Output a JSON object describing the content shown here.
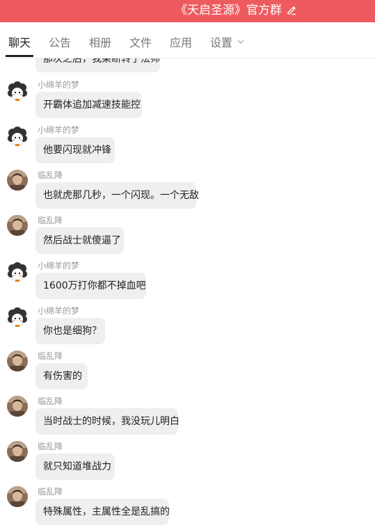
{
  "header": {
    "title": "《天启圣源》官方群",
    "background": "#ee5b5f"
  },
  "tabs": [
    {
      "label": "聊天",
      "active": true
    },
    {
      "label": "公告",
      "active": false
    },
    {
      "label": "相册",
      "active": false
    },
    {
      "label": "文件",
      "active": false
    },
    {
      "label": "应用",
      "active": false
    },
    {
      "label": "设置",
      "active": false,
      "has_dropdown": true
    }
  ],
  "icons": {
    "edit": "pencil-icon",
    "dropdown": "chevron-down-icon"
  },
  "messages": [
    {
      "sender": "",
      "avatar": "",
      "text": "那次之后，我果断转了法师"
    },
    {
      "sender": "小绵羊的梦",
      "avatar": "sheep-avatar",
      "text": "开霸体追加减速技能控"
    },
    {
      "sender": "小绵羊的梦",
      "avatar": "sheep-avatar",
      "text": "他要闪现就冲锋"
    },
    {
      "sender": "临乱降",
      "avatar": "photo-avatar",
      "text": "也就虎那几秒，一个闪现。一个无敌"
    },
    {
      "sender": "临乱降",
      "avatar": "photo-avatar",
      "text": "然后战士就傻逼了"
    },
    {
      "sender": "小绵羊的梦",
      "avatar": "sheep-avatar",
      "text": "1600万打你都不掉血吧"
    },
    {
      "sender": "小绵羊的梦",
      "avatar": "sheep-avatar",
      "text": "你也是细狗？"
    },
    {
      "sender": "临乱降",
      "avatar": "photo-avatar",
      "text": "有伤害的"
    },
    {
      "sender": "临乱降",
      "avatar": "photo-avatar",
      "text": "当时战士的时候，我没玩儿明白"
    },
    {
      "sender": "临乱降",
      "avatar": "photo-avatar",
      "text": "就只知道堆战力"
    },
    {
      "sender": "临乱降",
      "avatar": "photo-avatar",
      "text": "特殊属性，主属性全是乱搞的"
    }
  ]
}
